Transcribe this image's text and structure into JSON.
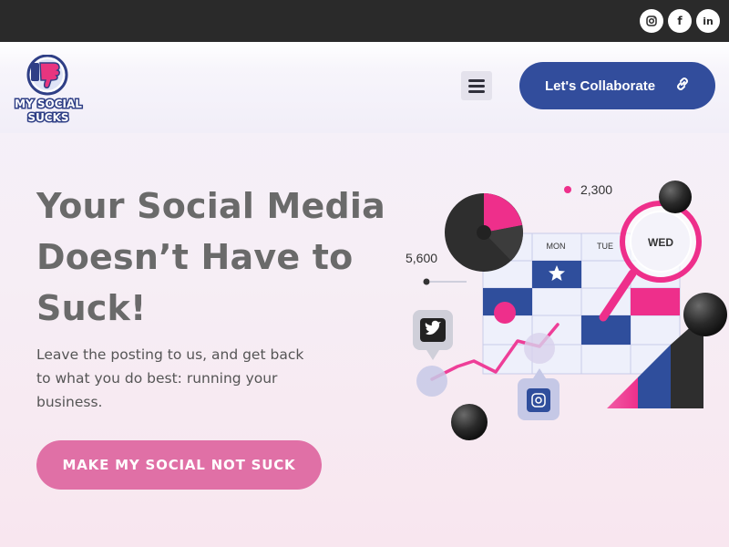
{
  "topbar": {
    "social": [
      {
        "name": "instagram",
        "glyph": "◎"
      },
      {
        "name": "facebook",
        "glyph": "f"
      },
      {
        "name": "linkedin",
        "glyph": "in"
      }
    ]
  },
  "header": {
    "logo": {
      "line1": "MY SOCIAL",
      "line2": "SUCKS"
    },
    "menu_icon": "hamburger-icon",
    "collab_label": "Let's Collaborate",
    "collab_icon": "link-icon"
  },
  "hero": {
    "headline": [
      "Your Social Media",
      "Doesn’t Have to",
      "Suck!"
    ],
    "subtext": [
      "Leave the posting to us, and get back",
      "to what you do best: running your",
      "business."
    ],
    "cta_label": "MAKE MY SOCIAL NOT SUCK"
  },
  "illustration": {
    "stat_top": "2,300",
    "stat_left": "5,600",
    "days": [
      "MON",
      "TUE",
      "WED"
    ]
  },
  "colors": {
    "topbar": "#2a2a2a",
    "collab_button": "#324d9c",
    "cta_button": "#e070a6",
    "headline": "#6a6a6a",
    "pink": "#ee2f8b",
    "blue": "#2f4e9c"
  }
}
